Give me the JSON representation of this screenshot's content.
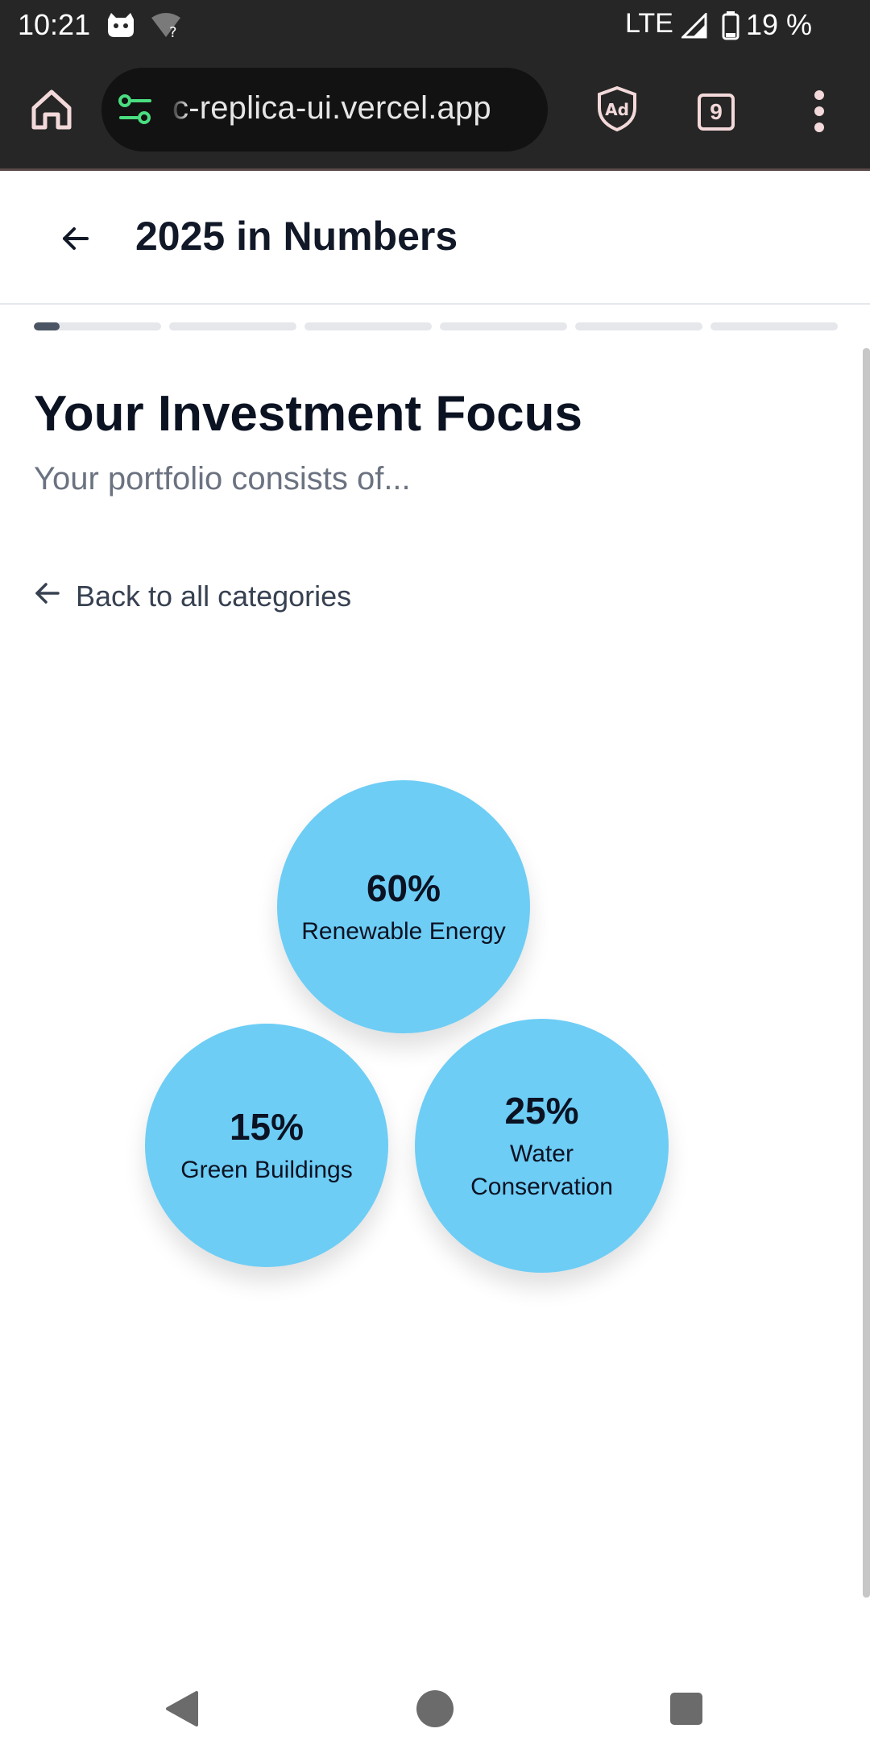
{
  "status_bar": {
    "time": "10:21",
    "network": "LTE",
    "battery": "19 %"
  },
  "browser": {
    "url": "c-replica-ui.vercel.app",
    "tab_count": "9"
  },
  "header": {
    "title": "2025 in Numbers"
  },
  "progress": {
    "total_steps": 6,
    "current_step": 1,
    "current_step_fill": 0.2
  },
  "main": {
    "title": "Your Investment Focus",
    "subtitle": "Your portfolio consists of...",
    "back_link_label": "Back to all categories"
  },
  "bubbles": [
    {
      "percent": "60%",
      "label": "Renewable Energy",
      "color": "#6dcdf5"
    },
    {
      "percent": "15%",
      "label": "Green Buildings",
      "color": "#6dcdf5"
    },
    {
      "percent": "25%",
      "label": "Water Conservation",
      "color": "#6dcdf5"
    }
  ],
  "colors": {
    "bubble": "#6dcdf5",
    "progress_active": "#4b5563",
    "progress_track": "#e5e7eb",
    "chrome_dark": "#262626"
  }
}
